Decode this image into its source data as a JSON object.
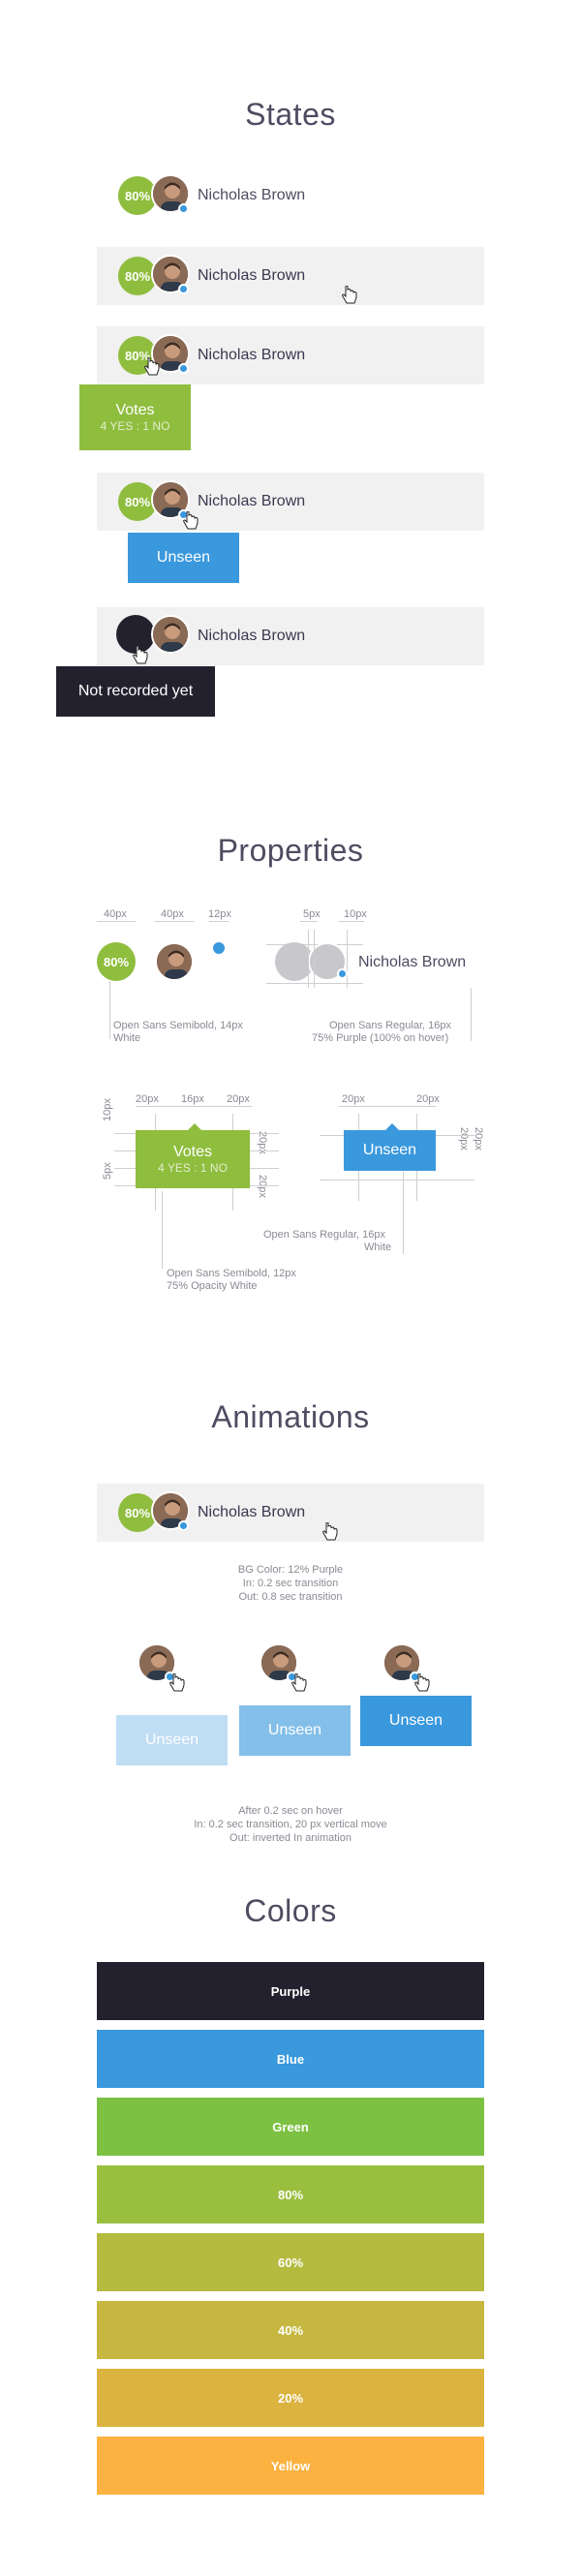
{
  "sections": {
    "states": "States",
    "properties": "Properties",
    "animations": "Animations",
    "colors": "Colors"
  },
  "user": {
    "name": "Nicholas Brown",
    "percent": "80%"
  },
  "tooltips": {
    "votes_title": "Votes",
    "votes_detail": "4 YES : 1 NO",
    "unseen": "Unseen",
    "not_recorded": "Not recorded yet"
  },
  "properties": {
    "dim_40a": "40px",
    "dim_40b": "40px",
    "dim_12": "12px",
    "dim_5": "5px",
    "dim_10": "10px",
    "font_pct_1": "Open Sans Semibold, 14px",
    "font_pct_2": "White",
    "font_name_1": "Open Sans Regular, 16px",
    "font_name_2": "75% Purple (100% on hover)",
    "tip_20a": "20px",
    "tip_16": "16px",
    "tip_20b": "20px",
    "tip_10": "10px",
    "tip_5": "5px",
    "tip_20c": "20px",
    "tip_20d": "20px",
    "tip_font_1": "Open Sans Semibold, 12px",
    "tip_font_2": "75% Opacity White",
    "unseen_20a": "20px",
    "unseen_20b": "20px",
    "unseen_20c": "20px",
    "unseen_20d": "20px",
    "unseen_font_1": "Open Sans Regular, 16px",
    "unseen_font_2": "White"
  },
  "animations": {
    "row_note_1": "BG Color: 12% Purple",
    "row_note_2": "In: 0.2 sec transition",
    "row_note_3": "Out: 0.8 sec transition",
    "tip_note_1": "After 0.2 sec on hover",
    "tip_note_2": "In: 0.2 sec transition, 20 px vertical move",
    "tip_note_3": "Out: inverted In animation"
  },
  "colors": [
    {
      "label": "Purple",
      "hex": "#24212f"
    },
    {
      "label": "Blue",
      "hex": "#3a98dd"
    },
    {
      "label": "Green",
      "hex": "#7dc143"
    },
    {
      "label": "80%",
      "hex": "#9abf3f"
    },
    {
      "label": "60%",
      "hex": "#b5bb3f"
    },
    {
      "label": "40%",
      "hex": "#c6b740"
    },
    {
      "label": "20%",
      "hex": "#dbb33f"
    },
    {
      "label": "Yellow",
      "hex": "#fcb240"
    }
  ]
}
